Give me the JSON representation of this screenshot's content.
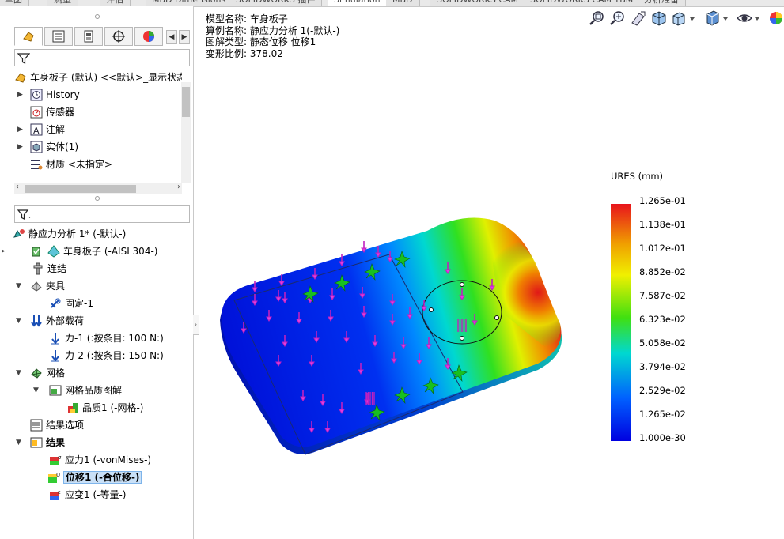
{
  "command_tabs": [
    "草图",
    "测量",
    "评估",
    "MBD Dimensions",
    "SOLIDWORKS 插件",
    "Simulation",
    "MBD",
    "SOLIDWORKS CAM",
    "SOLIDWORKS CAM TBM",
    "分析准备"
  ],
  "active_command_tab": "Simulation",
  "feature_tree": {
    "root": "车身板子 (默认) <<默认>_显示状态",
    "items": [
      {
        "label": "History",
        "icon": "history-icon"
      },
      {
        "label": "传感器",
        "icon": "sensor-icon"
      },
      {
        "label": "注解",
        "icon": "annotation-icon"
      },
      {
        "label": "实体(1)",
        "icon": "solid-body-icon"
      },
      {
        "label": "材质 <未指定>",
        "icon": "material-icon"
      }
    ]
  },
  "sim_tree": {
    "study": "静应力分析 1* (-默认-)",
    "part": "车身板子 (-AISI 304-)",
    "connections": "连结",
    "fixtures": "夹具",
    "fixed": "固定-1",
    "external_loads": "外部载荷",
    "force1": "力-1 (:按条目: 100 N:)",
    "force2": "力-2 (:按条目: 150 N:)",
    "mesh": "网格",
    "mesh_quality_plot": "网格品质图解",
    "quality1": "品质1 (-网格-)",
    "result_options": "结果选项",
    "results": "结果",
    "stress": "应力1 (-vonMises-)",
    "displacement": "位移1 (-合位移-)",
    "strain": "应变1 (-等量-)"
  },
  "plot_info": {
    "model_name": "模型名称: 车身板子",
    "study_name": "算例名称: 静应力分析 1(-默认-)",
    "plot_type": "图解类型: 静态位移 位移1",
    "deformation_scale": "变形比例: 378.02"
  },
  "legend": {
    "title": "URES (mm)",
    "labels": [
      "1.265e-01",
      "1.138e-01",
      "1.012e-01",
      "8.852e-02",
      "7.587e-02",
      "6.323e-02",
      "5.058e-02",
      "3.794e-02",
      "2.529e-02",
      "1.265e-02",
      "1.000e-30"
    ],
    "colors": [
      "#e8141c",
      "#f0a000",
      "#f0f000",
      "#40e010",
      "#00d8d0",
      "#0060ff",
      "#0000e0"
    ]
  },
  "toolbar_icons": [
    "zoom-to-fit-icon",
    "zoom-area-icon",
    "previous-view-icon",
    "section-view-icon",
    "view-orientation-icon",
    "display-style-icon",
    "hide-show-icon",
    "appearance-icon"
  ]
}
